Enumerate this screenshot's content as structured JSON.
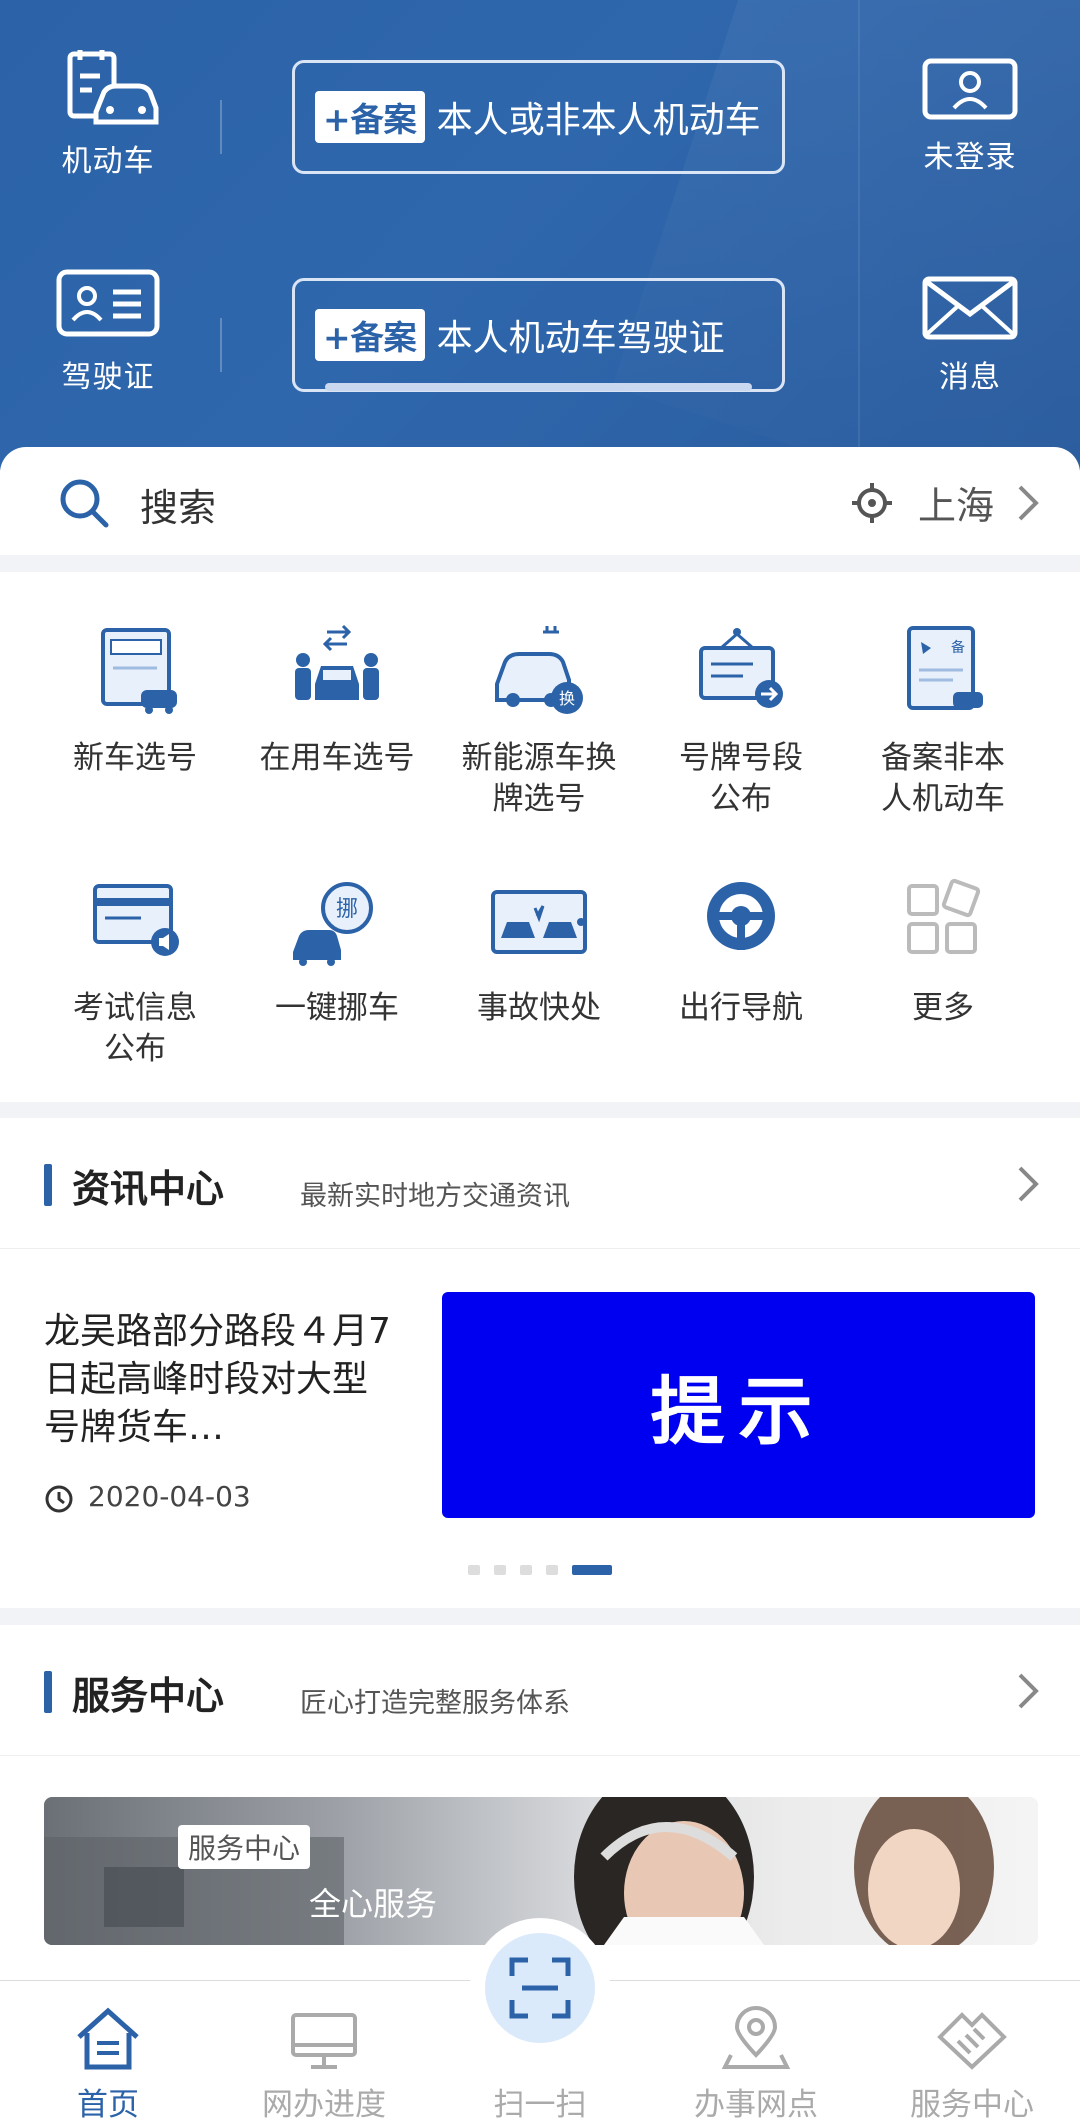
{
  "header": {
    "vehicle_label": "机动车",
    "license_label": "驾驶证",
    "login_label": "未登录",
    "message_label": "消息",
    "plate1_tag": "+备案",
    "plate1_text": "本人或非本人机动车",
    "plate2_tag": "+备案",
    "plate2_text": "本人机动车驾驶证"
  },
  "search": {
    "placeholder": "搜索",
    "city": "上海"
  },
  "services_grid": [
    {
      "label": "新车选号",
      "icon": "new-car-plate-icon"
    },
    {
      "label": "在用车选号",
      "icon": "used-car-plate-icon"
    },
    {
      "label": "新能源车换牌选号",
      "icon": "ev-plate-swap-icon"
    },
    {
      "label": "号牌号段公布",
      "icon": "plate-range-notice-icon"
    },
    {
      "label": "备案非本人机动车",
      "icon": "register-vehicle-icon"
    },
    {
      "label": "考试信息公布",
      "icon": "exam-info-icon"
    },
    {
      "label": "一键挪车",
      "icon": "move-car-icon"
    },
    {
      "label": "事故快处",
      "icon": "accident-icon"
    },
    {
      "label": "出行导航",
      "icon": "steering-wheel-icon"
    },
    {
      "label": "更多",
      "icon": "more-grid-icon"
    }
  ],
  "news": {
    "title": "资讯中心",
    "subtitle": "最新实时地方交通资讯",
    "item_title": "龙吴路部分路段４月7日起高峰时段对大型号牌货车…",
    "item_date": "2020-04-03",
    "banner_text": "提示"
  },
  "service_center": {
    "title": "服务中心",
    "subtitle": "匠心打造完整服务体系",
    "image_tag": "服务中心",
    "image_text": "全心服务"
  },
  "tabbar": [
    {
      "label": "首页",
      "icon": "home-icon",
      "active": true
    },
    {
      "label": "网办进度",
      "icon": "monitor-icon",
      "active": false
    },
    {
      "label": "扫一扫",
      "icon": "scan-icon",
      "active": false
    },
    {
      "label": "办事网点",
      "icon": "location-pin-icon",
      "active": false
    },
    {
      "label": "服务中心",
      "icon": "handshake-icon",
      "active": false
    }
  ],
  "colors": {
    "primary": "#2b62a8",
    "banner": "#0000f0"
  }
}
